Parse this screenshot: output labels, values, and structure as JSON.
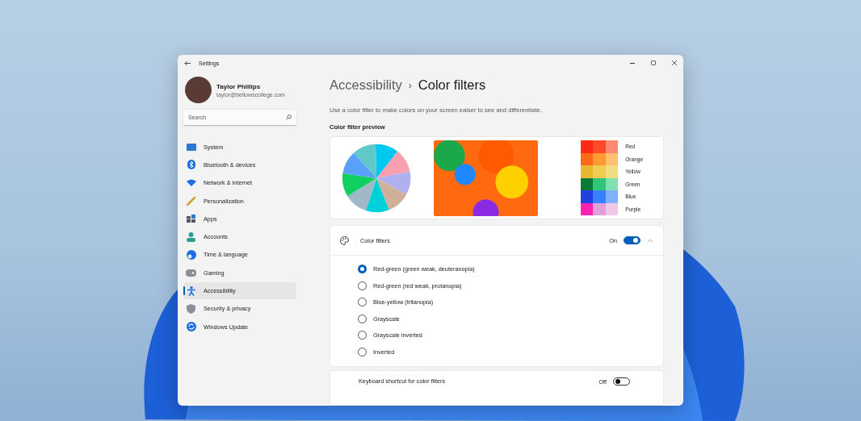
{
  "window": {
    "title": "Settings"
  },
  "profile": {
    "name": "Taylor Phillips",
    "email": "taylor@bellowscollege.com"
  },
  "search": {
    "placeholder": "Search"
  },
  "sidebar": {
    "items": [
      {
        "label": "System",
        "selected": false
      },
      {
        "label": "Bluetooth & devices",
        "selected": false
      },
      {
        "label": "Network & internet",
        "selected": false
      },
      {
        "label": "Personalization",
        "selected": false
      },
      {
        "label": "Apps",
        "selected": false
      },
      {
        "label": "Accounts",
        "selected": false
      },
      {
        "label": "Time & language",
        "selected": false
      },
      {
        "label": "Gaming",
        "selected": false
      },
      {
        "label": "Accessibility",
        "selected": true
      },
      {
        "label": "Security & privacy",
        "selected": false
      },
      {
        "label": "Windows Update",
        "selected": false
      }
    ]
  },
  "breadcrumb": {
    "parent": "Accessibility",
    "separator": "›",
    "current": "Color filters"
  },
  "description": "Use a color filter to make colors on your screen eaiser to see and differentiate.",
  "preview": {
    "heading": "Color filter preview",
    "swatches": [
      {
        "label": "Red",
        "cells": [
          {
            "color": "#ff2a14"
          },
          {
            "color": "#ff4a2a"
          },
          {
            "color": "#ff8a72"
          }
        ]
      },
      {
        "label": "Orange",
        "cells": [
          {
            "color": "#ff6a18"
          },
          {
            "color": "#ff9a30"
          },
          {
            "color": "#ffc070"
          }
        ]
      },
      {
        "label": "Yellow",
        "cells": [
          {
            "color": "#e8b830"
          },
          {
            "color": "#f0cc50"
          },
          {
            "color": "#f2dc80"
          }
        ]
      },
      {
        "label": "Green",
        "cells": [
          {
            "color": "#0a7a3a"
          },
          {
            "color": "#30c878"
          },
          {
            "color": "#80e0b0"
          }
        ]
      },
      {
        "label": "Blue",
        "cells": [
          {
            "color": "#2040e0"
          },
          {
            "color": "#3880ff"
          },
          {
            "color": "#80b0ff"
          }
        ]
      },
      {
        "label": "Purple",
        "cells": [
          {
            "color": "#ff20b0"
          },
          {
            "color": "#e0a0d8"
          },
          {
            "color": "#f0c8e8"
          }
        ]
      }
    ]
  },
  "color_filters": {
    "label": "Color filters",
    "state": "On",
    "on": true,
    "expanded": true,
    "options": [
      {
        "label": "Red-green (green weak, deuteranopia)",
        "selected": true
      },
      {
        "label": "Red-green (red weak, protanopia)",
        "selected": false
      },
      {
        "label": "Blue-yellow (tritanopia)",
        "selected": false
      },
      {
        "label": "Grayscale",
        "selected": false
      },
      {
        "label": "Grayscale inverted",
        "selected": false
      },
      {
        "label": "Inverted",
        "selected": false
      }
    ]
  },
  "keyboard_shortcut": {
    "label": "Keyboard shortcut for color filters",
    "state": "Off",
    "on": false
  }
}
